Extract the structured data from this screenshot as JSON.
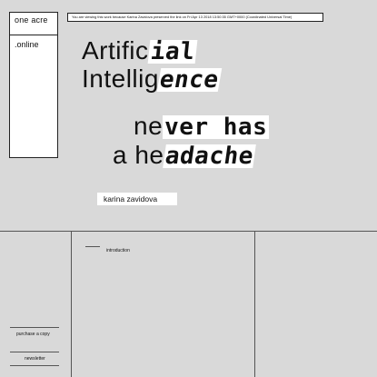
{
  "logo": {
    "name": "one acre",
    "domain": ".online"
  },
  "notice": "You are viewing this work because Karina Zavidova preserved the link on Fri Apr 13 2018 13:50:35 GMT+0000 (Coordinated Universal Time)",
  "title": {
    "line1_a": "Artific",
    "line1_b": "ial",
    "line2_a": "Intellig",
    "line2_b": "ence",
    "line3_a": "ne",
    "line3_b": "ver has",
    "line4_a": "a he",
    "line4_b": "adache"
  },
  "author": "karina zavidova",
  "nav": {
    "introduction": "introduction",
    "purchase": "purchase a copy",
    "newsletter": "newsletter"
  },
  "colors": {
    "background": "#d9d9d9",
    "panel": "#ffffff",
    "ink": "#111111"
  }
}
